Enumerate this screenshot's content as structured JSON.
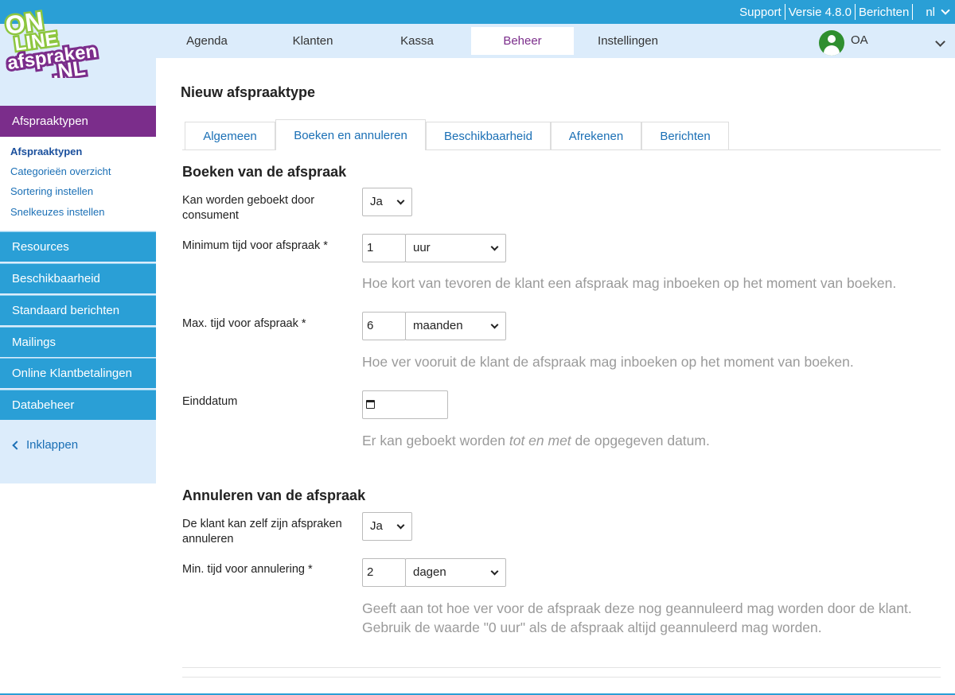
{
  "top_links": {
    "support": "Support",
    "version": "Versie 4.8.0",
    "messages": "Berichten",
    "lang": "nl"
  },
  "logo": {
    "line1": "ON",
    "line2": "LINE",
    "line3": "afspraken",
    "line4": ".NL"
  },
  "nav": {
    "items": [
      "Agenda",
      "Klanten",
      "Kassa",
      "Beheer",
      "Instellingen"
    ],
    "active": "Beheer",
    "user": "OA"
  },
  "sidebar": {
    "active_section": "Afspraaktypen",
    "sub_items": [
      "Afspraaktypen",
      "Categorieën overzicht",
      "Sortering instellen",
      "Snelkeuzes instellen"
    ],
    "sections": [
      "Resources",
      "Beschikbaarheid",
      "Standaard berichten",
      "Mailings",
      "Online Klantbetalingen",
      "Databeheer"
    ],
    "collapse": "Inklappen"
  },
  "page": {
    "title": "Nieuw afspraaktype",
    "tabs": [
      "Algemeen",
      "Boeken en annuleren",
      "Beschikbaarheid",
      "Afrekenen",
      "Berichten"
    ],
    "active_tab": "Boeken en annuleren"
  },
  "booking": {
    "heading": "Boeken van de afspraak",
    "bookable_label": "Kan worden geboekt door consument",
    "bookable_value": "Ja",
    "min_label": "Minimum tijd voor afspraak *",
    "min_value": "1",
    "min_unit": "uur",
    "min_help": "Hoe kort van tevoren de klant een afspraak mag inboeken op het moment van boeken.",
    "max_label": "Max. tijd voor afspraak *",
    "max_value": "6",
    "max_unit": "maanden",
    "max_help": "Hoe ver vooruit de klant de afspraak mag inboeken op het moment van boeken.",
    "end_label": "Einddatum",
    "end_help_pre": "Er kan geboekt worden ",
    "end_help_em": "tot en met",
    "end_help_post": " de opgegeven datum."
  },
  "cancel": {
    "heading": "Annuleren van de afspraak",
    "self_label": "De klant kan zelf zijn afspraken annuleren",
    "self_value": "Ja",
    "min_label": "Min. tijd voor annulering *",
    "min_value": "2",
    "min_unit": "dagen",
    "help_line1": "Geeft aan tot hoe ver voor de afspraak deze nog geannuleerd mag worden door de klant.",
    "help_line2": "Gebruik de waarde \"0 uur\" als de afspraak altijd geannuleerd mag worden."
  },
  "colors": {
    "primary_blue": "#2a9fd6",
    "purple": "#7b2d8b",
    "light_blue": "#dcecfb",
    "logo_green": "#8dc63f"
  }
}
